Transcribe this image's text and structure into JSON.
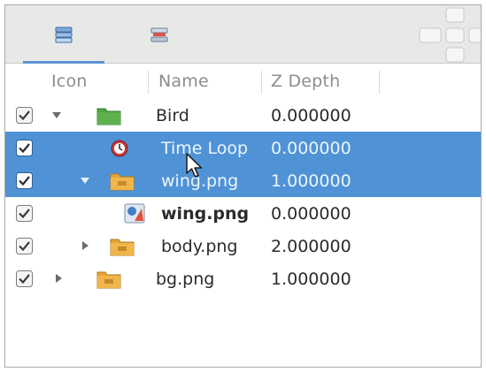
{
  "tabs": [
    {
      "name": "layers-tab-icon",
      "active": true
    },
    {
      "name": "properties-tab-icon",
      "active": false
    }
  ],
  "columns": {
    "icon": "Icon",
    "name": "Name",
    "zdepth": "Z Depth"
  },
  "rows": [
    {
      "name": "Bird",
      "z": "0.000000",
      "checked": true,
      "selected": false,
      "expander": "expanded",
      "icon": "group-folder-icon",
      "bold": false
    },
    {
      "name": "Time Loop",
      "z": "0.000000",
      "checked": true,
      "selected": true,
      "expander": "none",
      "icon": "time-loop-icon",
      "bold": false
    },
    {
      "name": "wing.png",
      "z": "1.000000",
      "checked": true,
      "selected": true,
      "expander": "expanded",
      "icon": "switch-folder-icon",
      "bold": false
    },
    {
      "name": "wing.png",
      "z": "0.000000",
      "checked": true,
      "selected": false,
      "expander": "none",
      "icon": "image-layer-icon",
      "bold": true
    },
    {
      "name": "body.png",
      "z": "2.000000",
      "checked": true,
      "selected": false,
      "expander": "collapsed",
      "icon": "switch-folder-icon",
      "bold": false
    },
    {
      "name": "bg.png",
      "z": "1.000000",
      "checked": true,
      "selected": false,
      "expander": "collapsed",
      "icon": "switch-folder-icon",
      "bold": false
    }
  ],
  "colors": {
    "selection": "#4f93d6",
    "folder_green": "#5fb04f",
    "folder_orange": "#f0b64a",
    "tab_accent": "#5b95cf"
  }
}
